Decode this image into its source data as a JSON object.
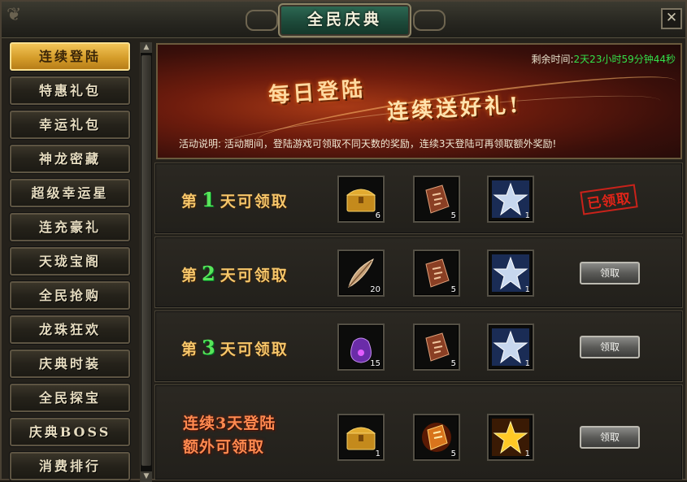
{
  "window": {
    "title": "全民庆典",
    "close_label": "✕"
  },
  "sidebar": {
    "items": [
      {
        "label": "连续登陆",
        "active": true
      },
      {
        "label": "特惠礼包"
      },
      {
        "label": "幸运礼包"
      },
      {
        "label": "神龙密藏"
      },
      {
        "label": "超级幸运星"
      },
      {
        "label": "连充豪礼"
      },
      {
        "label": "天珑宝阁"
      },
      {
        "label": "全民抢购"
      },
      {
        "label": "龙珠狂欢"
      },
      {
        "label": "庆典时装"
      },
      {
        "label": "全民探宝"
      },
      {
        "label": "庆典BOSS"
      },
      {
        "label": "消费排行"
      }
    ]
  },
  "banner": {
    "timer_label": "剩余时间:",
    "timer_value": "2天23小时59分钟44秒",
    "headline_1": "每日登陆",
    "headline_2": "连续送好礼!",
    "description": "活动说明:  活动期间，登陆游戏可领取不同天数的奖励，连续3天登陆可再领取额外奖励!"
  },
  "rewards": [
    {
      "prefix": "第",
      "day": "1",
      "suffix": "天可领取",
      "items": [
        {
          "icon": "golden-chest-icon",
          "count": "6"
        },
        {
          "icon": "rune-tablet-icon",
          "count": "5"
        },
        {
          "icon": "silver-star-icon",
          "count": "1"
        }
      ],
      "status": "claimed",
      "stamp": "已领取"
    },
    {
      "prefix": "第",
      "day": "2",
      "suffix": "天可领取",
      "items": [
        {
          "icon": "feather-icon",
          "count": "20"
        },
        {
          "icon": "rune-tablet-icon",
          "count": "5"
        },
        {
          "icon": "silver-star-icon",
          "count": "1"
        }
      ],
      "status": "available",
      "button": "领取"
    },
    {
      "prefix": "第",
      "day": "3",
      "suffix": "天可领取",
      "items": [
        {
          "icon": "purple-pouch-icon",
          "count": "15"
        },
        {
          "icon": "rune-tablet-icon",
          "count": "5"
        },
        {
          "icon": "silver-star-icon",
          "count": "1"
        }
      ],
      "status": "available",
      "button": "领取"
    },
    {
      "bonus_line_1": "连续3天登陆",
      "bonus_line_2": "额外可领取",
      "items": [
        {
          "icon": "golden-chest-icon",
          "count": "1"
        },
        {
          "icon": "fire-rune-icon",
          "count": "5"
        },
        {
          "icon": "gold-star-icon",
          "count": "1"
        }
      ],
      "status": "available",
      "button": "领取"
    }
  ],
  "colors": {
    "accent_gold": "#d59d2a",
    "day_number_green": "#58e55a",
    "timer_green": "#33e04a",
    "stamp_red": "#e02418"
  }
}
